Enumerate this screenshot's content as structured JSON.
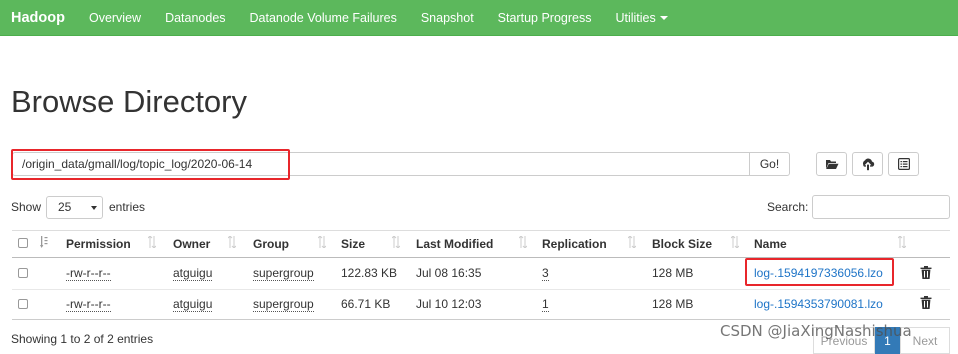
{
  "navbar": {
    "brand": "Hadoop",
    "items": [
      "Overview",
      "Datanodes",
      "Datanode Volume Failures",
      "Snapshot",
      "Startup Progress"
    ],
    "utilities": "Utilities"
  },
  "page": {
    "title": "Browse Directory"
  },
  "path_bar": {
    "value": "/origin_data/gmall/log/topic_log/2020-06-14",
    "go_label": "Go!"
  },
  "toolbar": {
    "icons": [
      "folder-open-icon",
      "upload-icon",
      "list-icon"
    ]
  },
  "length_control": {
    "show_label": "Show",
    "value": "25",
    "entries_label": "entries"
  },
  "search": {
    "label": "Search:",
    "value": ""
  },
  "table": {
    "columns": [
      "Permission",
      "Owner",
      "Group",
      "Size",
      "Last Modified",
      "Replication",
      "Block Size",
      "Name"
    ],
    "rows": [
      {
        "permission": "-rw-r--r--",
        "owner": "atguigu",
        "group": "supergroup",
        "size": "122.83 KB",
        "modified": "Jul 08 16:35",
        "replication": "3",
        "block_size": "128 MB",
        "name": "log-.1594197336056.lzo"
      },
      {
        "permission": "-rw-r--r--",
        "owner": "atguigu",
        "group": "supergroup",
        "size": "66.71 KB",
        "modified": "Jul 10 12:03",
        "replication": "1",
        "block_size": "128 MB",
        "name": "log-.1594353790081.lzo"
      }
    ]
  },
  "footer": {
    "info": "Showing 1 to 2 of 2 entries"
  },
  "pagination": {
    "previous": "Previous",
    "current": "1",
    "next": "Next"
  },
  "watermark": "CSDN @JiaXingNashishua",
  "colors": {
    "navbar": "#5cb85c",
    "link": "#1e74c7",
    "highlight": "#e8262b",
    "page_active": "#337ab7"
  }
}
